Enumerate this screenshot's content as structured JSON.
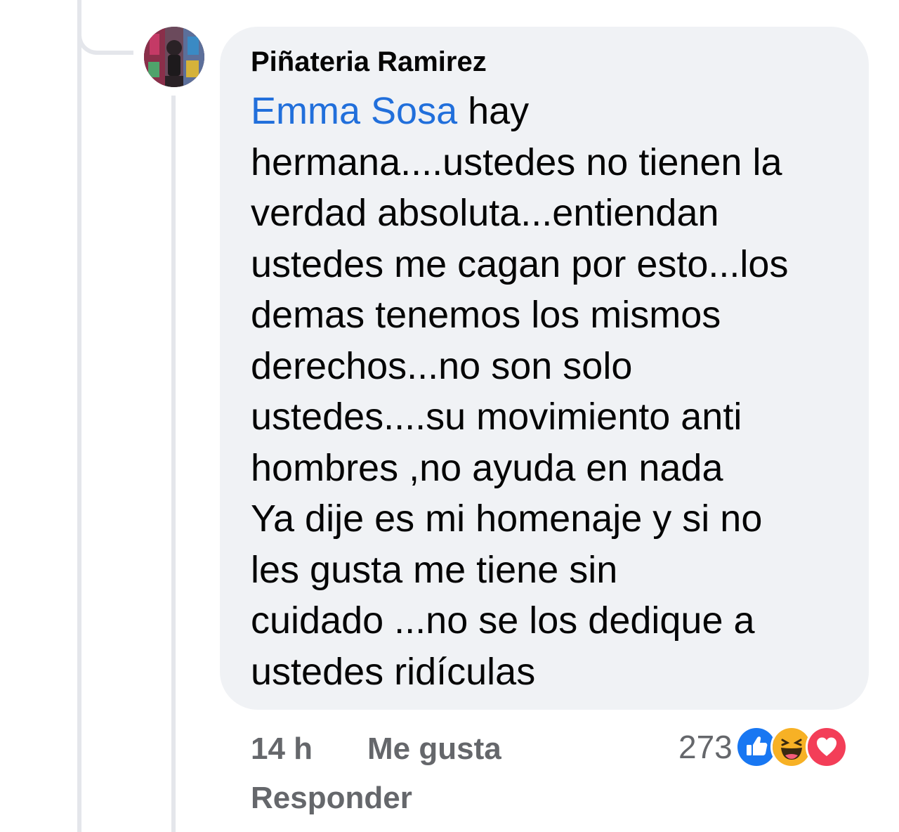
{
  "comment": {
    "author": "Piñateria Ramirez",
    "mention": "Emma Sosa",
    "first_line_rest": " hay",
    "lines": [
      "hermana....ustedes no tienen la",
      "verdad absoluta...entiendan",
      "ustedes me cagan por esto...los",
      "demas tenemos los mismos",
      "derechos...no son solo",
      "ustedes....su movimiento anti",
      "hombres ,no ayuda en nada",
      "Ya dije es mi homenaje y si no",
      "les gusta me tiene sin",
      "cuidado ...no se los dedique a",
      "ustedes ridículas"
    ]
  },
  "actions": {
    "time": "14 h",
    "like_label": "Me gusta",
    "reply_label": "Responder"
  },
  "reactions": {
    "count": "273",
    "icons": [
      "like-icon",
      "haha-icon",
      "love-icon"
    ]
  },
  "colors": {
    "bubble": "#f0f2f5",
    "mention": "#216fdb",
    "meta_text": "#65676b",
    "like_blue": "#1877f2",
    "love_red": "#f33e58",
    "haha_yellow": "#f7b125"
  }
}
